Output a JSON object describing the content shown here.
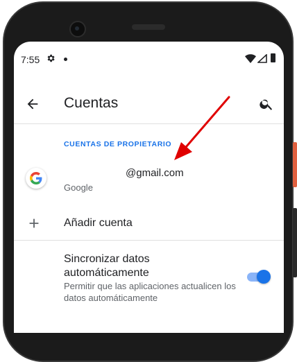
{
  "status_bar": {
    "time": "7:55",
    "settings_icon": "gear-icon",
    "wifi_icon": "wifi-icon",
    "signal_icon": "cell-signal-icon",
    "battery_icon": "battery-icon"
  },
  "app_bar": {
    "title": "Cuentas",
    "back_icon": "arrow-back-icon",
    "search_icon": "search-icon"
  },
  "accounts": {
    "section_header": "CUENTAS DE PROPIETARIO",
    "items": [
      {
        "email": "@gmail.com",
        "type": "Google",
        "icon": "google-logo-icon"
      }
    ]
  },
  "add_account": {
    "label": "Añadir cuenta",
    "icon": "plus-icon"
  },
  "sync": {
    "title": "Sincronizar datos automáticamente",
    "description": "Permitir que las aplicaciones actualicen los datos automáticamente",
    "enabled": true
  },
  "colors": {
    "accent": "#1a73e8",
    "annotation_arrow": "#e00000",
    "device_accent_button": "#e0603f"
  }
}
